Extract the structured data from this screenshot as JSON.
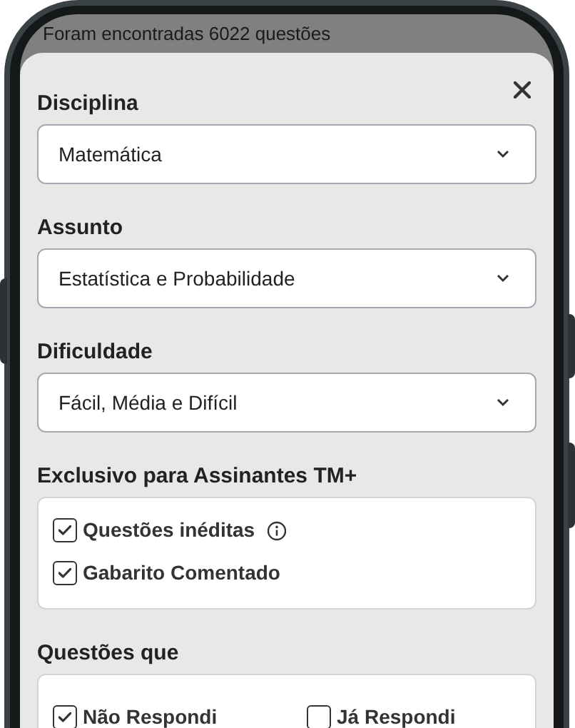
{
  "status_text": "Foram encontradas 6022 questões",
  "filters": [
    {
      "label": "Disciplina",
      "value": "Matemática"
    },
    {
      "label": "Assunto",
      "value": "Estatística e Probabilidade"
    },
    {
      "label": "Dificuldade",
      "value": "Fácil, Média e Difícil"
    }
  ],
  "exclusive": {
    "label": "Exclusivo para Assinantes TM+",
    "options": [
      {
        "label": "Questões inéditas",
        "checked": true,
        "info": true
      },
      {
        "label": "Gabarito Comentado",
        "checked": true,
        "info": false
      }
    ]
  },
  "answered": {
    "label": "Questões que",
    "options": [
      {
        "label": "Não Respondi",
        "checked": true
      },
      {
        "label": "Já Respondi",
        "checked": false
      }
    ]
  }
}
